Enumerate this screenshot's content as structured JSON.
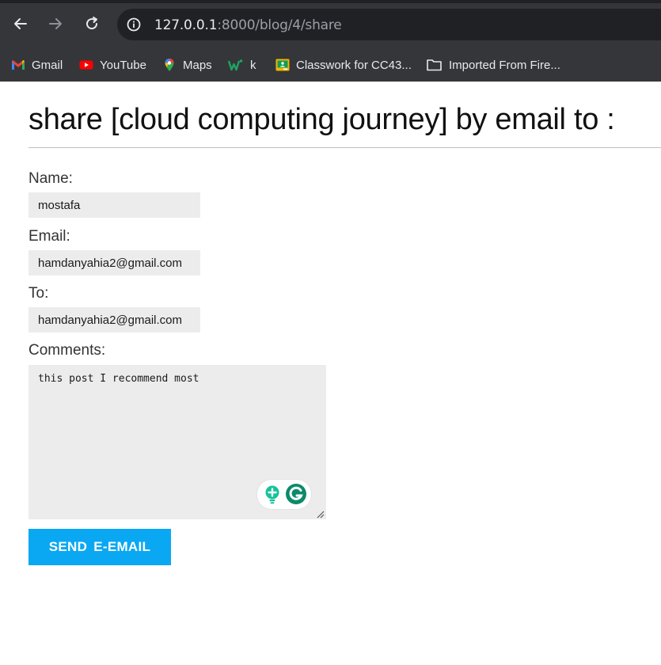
{
  "browser": {
    "url_host": "127.0.0.1",
    "url_rest": ":8000/blog/4/share",
    "bookmarks": [
      {
        "label": "Gmail",
        "icon": "gmail-icon"
      },
      {
        "label": "YouTube",
        "icon": "youtube-icon"
      },
      {
        "label": "Maps",
        "icon": "maps-icon"
      },
      {
        "label": "k",
        "icon": "w-icon"
      },
      {
        "label": "Classwork for CC43...",
        "icon": "classroom-icon"
      },
      {
        "label": "Imported From Fire...",
        "icon": "folder-icon"
      }
    ]
  },
  "page": {
    "title": "share [cloud computing journey] by email to :"
  },
  "form": {
    "name_label": "Name:",
    "name_value": "mostafa",
    "email_label": "Email:",
    "email_value": "hamdanyahia2@gmail.com",
    "to_label": "To:",
    "to_value": "hamdanyahia2@gmail.com",
    "comments_label": "Comments:",
    "comments_value": "this post I recommend most",
    "submit_label": "SEND  E-EMAIL"
  },
  "colors": {
    "chrome_bg": "#35363a",
    "omnibox_bg": "#202124",
    "field_bg": "#ececec",
    "button_bg": "#0aa8f2",
    "grammarly_green": "#15c39a",
    "grammarly_dark": "#0d8a6a"
  }
}
